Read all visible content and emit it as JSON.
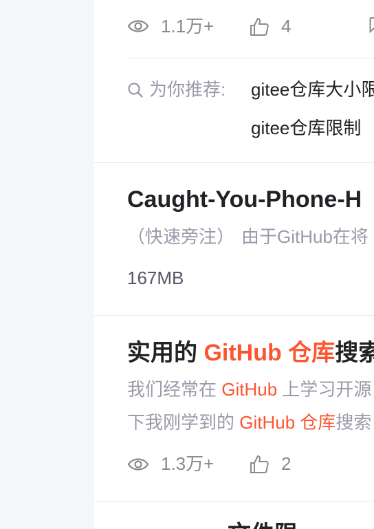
{
  "result1": {
    "views": "1.1万+",
    "likes": "4",
    "recommend_label": "为你推荐:",
    "recommend_links": [
      "gitee仓库大小限",
      "gitee仓库限制"
    ]
  },
  "result2": {
    "title": "Caught-You-Phone-H",
    "desc_a": "（快速旁注）",
    "desc_b": "由于GitHub在将",
    "size": "167MB"
  },
  "result3": {
    "title_pre": "实用的 ",
    "title_hl": "GitHub 仓库",
    "title_post": "搜索",
    "desc1_pre": "我们经常在 ",
    "desc1_hl": "GitHub",
    "desc1_post": " 上学习开源",
    "desc2_pre": "下我刚学到的 ",
    "desc2_hl": "GitHub 仓库",
    "desc2_post": "搜索",
    "views": "1.3万+",
    "likes": "2"
  },
  "result4": {
    "title_partial": "…文件限"
  },
  "colors": {
    "highlight": "#fc5531",
    "muted": "#999aaa",
    "title": "#222226"
  }
}
